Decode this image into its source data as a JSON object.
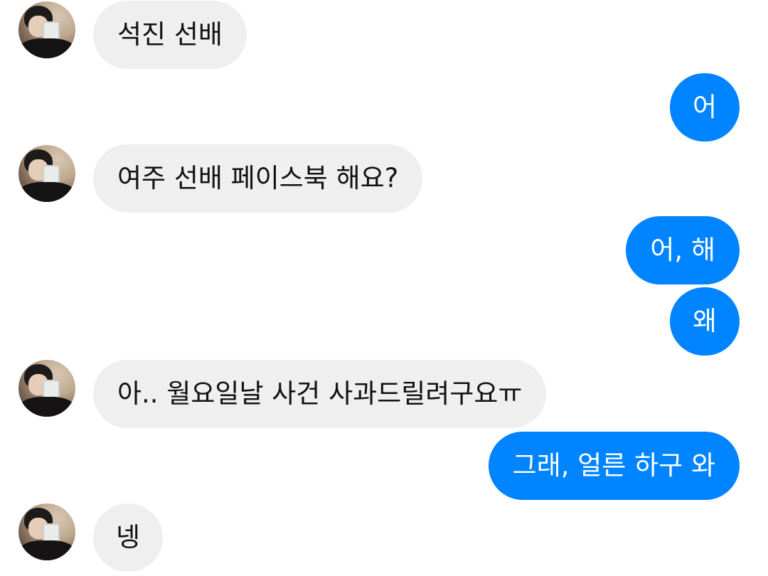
{
  "colors": {
    "incoming_bubble": "#efefef",
    "outgoing_bubble": "#0084ff",
    "incoming_text": "#111111",
    "outgoing_text": "#ffffff",
    "background": "#ffffff"
  },
  "messages": [
    {
      "direction": "incoming",
      "text": "석진 선배"
    },
    {
      "direction": "outgoing",
      "text": "어"
    },
    {
      "direction": "incoming",
      "text": "여주 선배 페이스북 해요?"
    },
    {
      "direction": "outgoing",
      "text": "어, 해"
    },
    {
      "direction": "outgoing",
      "text": "왜"
    },
    {
      "direction": "incoming",
      "text": "아.. 월요일날 사건 사과드릴려구요ㅠ"
    },
    {
      "direction": "outgoing",
      "text": "그래, 얼른 하구 와"
    },
    {
      "direction": "incoming",
      "text": "넹"
    }
  ]
}
